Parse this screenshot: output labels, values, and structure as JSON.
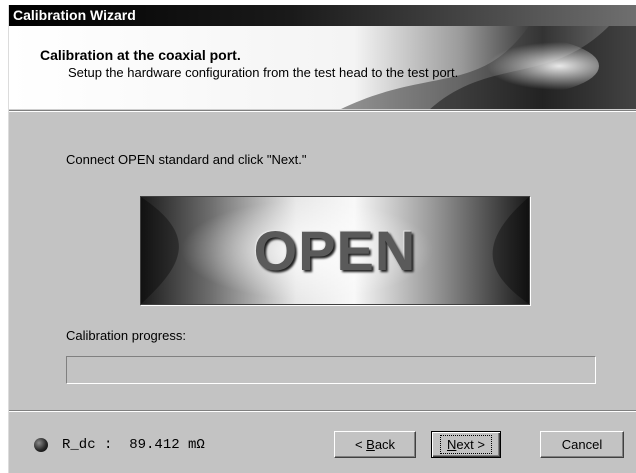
{
  "window": {
    "title": "Calibration Wizard"
  },
  "header": {
    "title": "Calibration at the coaxial port.",
    "subtitle": "Setup the hardware configuration from the test head to the test port."
  },
  "main": {
    "instruction": "Connect OPEN standard and click \"Next.\"",
    "standard_label": "OPEN",
    "progress_label": "Calibration progress:",
    "progress_value": 0
  },
  "status": {
    "readout": "R_dc :  89.412 mΩ",
    "indicator_icon": "led-indicator-icon"
  },
  "buttons": {
    "back_prefix": "< ",
    "back_mnemonic": "B",
    "back_rest": "ack",
    "next_mnemonic": "N",
    "next_rest": "ext >",
    "cancel": "Cancel"
  }
}
